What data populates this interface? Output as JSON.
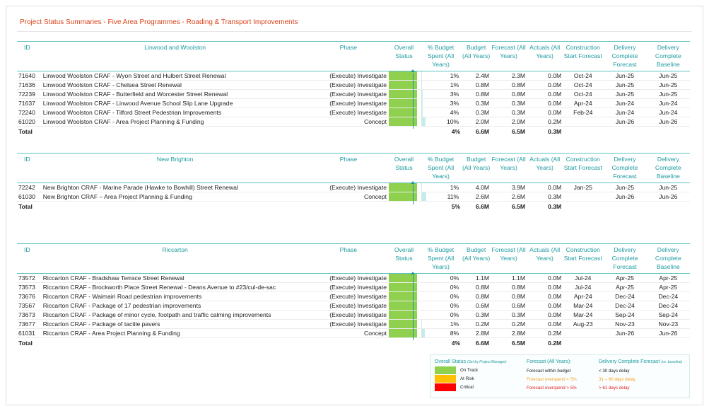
{
  "report_title": "Project Status Summaries - Five Area Programmes - Roading & Transport Improvements",
  "columns": {
    "id": "ID",
    "phase": "Phase",
    "overall_status": "Overall Status",
    "budget_spent": "% Budget Spent (All Years)",
    "budget": "Budget (All Years)",
    "forecast": "Forecast (All Years)",
    "actuals": "Actuals (All Years)",
    "construction_start": "Construction Start Forecast",
    "delivery_forecast": "Delivery Complete Forecast",
    "delivery_baseline": "Delivery Complete Baseline"
  },
  "sections": [
    {
      "name": "Linwood and Woolston",
      "rows": [
        {
          "id": "71640",
          "name": "Linwood Woolston CRAF - Wyon Street and Hulbert Street Renewal",
          "phase": "(Execute) Investigate",
          "status": "On Track",
          "pct": "1%",
          "pct_value": 1,
          "budget": "2.4M",
          "forecast": "2.3M",
          "actuals": "0.0M",
          "cons": "Oct-24",
          "deliv_f": "Jun-25",
          "deliv_b": "Jun-25"
        },
        {
          "id": "71636",
          "name": "Linwood Woolston CRAF - Chelsea Street Renewal",
          "phase": "(Execute) Investigate",
          "status": "On Track",
          "pct": "1%",
          "pct_value": 1,
          "budget": "0.8M",
          "forecast": "0.8M",
          "actuals": "0.0M",
          "cons": "Oct-24",
          "deliv_f": "Jun-25",
          "deliv_b": "Jun-25"
        },
        {
          "id": "72239",
          "name": "Linwood Woolston CRAF - Butterfield and Worcester Street Renewal",
          "phase": "(Execute) Investigate",
          "status": "On Track",
          "pct": "3%",
          "pct_value": 3,
          "budget": "0.8M",
          "forecast": "0.8M",
          "actuals": "0.0M",
          "cons": "Oct-24",
          "deliv_f": "Jun-25",
          "deliv_b": "Jun-25"
        },
        {
          "id": "71637",
          "name": "Linwood Woolston CRAF - Linwood Avenue School Slip Lane Upgrade",
          "phase": "(Execute) Investigate",
          "status": "On Track",
          "pct": "3%",
          "pct_value": 3,
          "budget": "0.3M",
          "forecast": "0.3M",
          "actuals": "0.0M",
          "cons": "Apr-24",
          "deliv_f": "Jun-24",
          "deliv_b": "Jun-24"
        },
        {
          "id": "72240",
          "name": "Linwood Woolston CRAF - Tilford Street Pedestrian Improvements",
          "phase": "(Execute) Investigate",
          "status": "On Track",
          "pct": "4%",
          "pct_value": 4,
          "budget": "0.3M",
          "forecast": "0.3M",
          "actuals": "0.0M",
          "cons": "Feb-24",
          "deliv_f": "Jun-24",
          "deliv_b": "Jun-24"
        },
        {
          "id": "61020",
          "name": "Linwood Woolston CRAF - Area Project Planning & Funding",
          "phase": "Concept",
          "status": "On Track",
          "pct": "10%",
          "pct_value": 10,
          "budget": "2.0M",
          "forecast": "2.0M",
          "actuals": "0.2M",
          "cons": "",
          "deliv_f": "Jun-26",
          "deliv_b": "Jun-26"
        }
      ],
      "total": {
        "label": "Total",
        "pct": "4%",
        "budget": "6.6M",
        "forecast": "6.5M",
        "actuals": "0.3M"
      }
    },
    {
      "name": "New Brighton",
      "rows": [
        {
          "id": "72242",
          "name": "New Brighton CRAF - Marine Parade (Hawke to Bowhill) Street Renewal",
          "phase": "(Execute) Investigate",
          "status": "On Track",
          "pct": "1%",
          "pct_value": 1,
          "budget": "4.0M",
          "forecast": "3.9M",
          "actuals": "0.0M",
          "cons": "Jan-25",
          "deliv_f": "Jun-25",
          "deliv_b": "Jun-25"
        },
        {
          "id": "61030",
          "name": "New Brighton CRAF – Area Project Planning & Funding",
          "phase": "Concept",
          "status": "On Track",
          "pct": "11%",
          "pct_value": 11,
          "budget": "2.6M",
          "forecast": "2.6M",
          "actuals": "0.3M",
          "cons": "",
          "deliv_f": "Jun-26",
          "deliv_b": "Jun-26"
        }
      ],
      "total": {
        "label": "Total",
        "pct": "5%",
        "budget": "6.6M",
        "forecast": "6.5M",
        "actuals": "0.3M"
      }
    },
    {
      "name": "Riccarton",
      "rows": [
        {
          "id": "73572",
          "name": "Riccarton CRAF - Bradshaw Terrace Street Renewal",
          "phase": "(Execute) Investigate",
          "status": "On Track",
          "pct": "0%",
          "pct_value": 0,
          "budget": "1.1M",
          "forecast": "1.1M",
          "actuals": "0.0M",
          "cons": "Jul-24",
          "deliv_f": "Apr-25",
          "deliv_b": "Apr-25"
        },
        {
          "id": "73573",
          "name": "Riccarton CRAF - Brockworth Place Street Renewal - Deans Avenue to #23/cul-de-sac",
          "phase": "(Execute) Investigate",
          "status": "On Track",
          "pct": "0%",
          "pct_value": 0,
          "budget": "0.8M",
          "forecast": "0.8M",
          "actuals": "0.0M",
          "cons": "Jul-24",
          "deliv_f": "Apr-25",
          "deliv_b": "Apr-25"
        },
        {
          "id": "73676",
          "name": "Riccarton CRAF - Waimairi Road pedestrian improvements",
          "phase": "(Execute) Investigate",
          "status": "On Track",
          "pct": "0%",
          "pct_value": 0,
          "budget": "0.8M",
          "forecast": "0.8M",
          "actuals": "0.0M",
          "cons": "Apr-24",
          "deliv_f": "Dec-24",
          "deliv_b": "Dec-24"
        },
        {
          "id": "73567",
          "name": "Riccarton CRAF - Package of 17 pedestrian improvements",
          "phase": "(Execute) Investigate",
          "status": "On Track",
          "pct": "0%",
          "pct_value": 0,
          "budget": "0.6M",
          "forecast": "0.6M",
          "actuals": "0.0M",
          "cons": "Mar-24",
          "deliv_f": "Dec-24",
          "deliv_b": "Dec-24"
        },
        {
          "id": "73673",
          "name": "Riccarton CRAF - Package of minor cycle, footpath and traffic calming improvements",
          "phase": "(Execute) Investigate",
          "status": "On Track",
          "pct": "0%",
          "pct_value": 0,
          "budget": "0.3M",
          "forecast": "0.3M",
          "actuals": "0.0M",
          "cons": "Mar-24",
          "deliv_f": "Sep-24",
          "deliv_b": "Sep-24"
        },
        {
          "id": "73677",
          "name": "Riccarton CRAF - Package of tactile pavers",
          "phase": "(Execute) Investigate",
          "status": "On Track",
          "pct": "1%",
          "pct_value": 1,
          "budget": "0.2M",
          "forecast": "0.2M",
          "actuals": "0.0M",
          "cons": "Aug-23",
          "deliv_f": "Nov-23",
          "deliv_b": "Nov-23"
        },
        {
          "id": "61031",
          "name": "Riccarton CRAF - Area Project Planning & Funding",
          "phase": "Concept",
          "status": "On Track",
          "pct": "8%",
          "pct_value": 8,
          "budget": "2.8M",
          "forecast": "2.8M",
          "actuals": "0.2M",
          "cons": "",
          "deliv_f": "Jun-26",
          "deliv_b": "Jun-26"
        }
      ],
      "total": {
        "label": "Total",
        "pct": "4%",
        "budget": "6.6M",
        "forecast": "6.5M",
        "actuals": "0.2M"
      }
    }
  ],
  "legend": {
    "status_title": "Overall Status",
    "status_note": "(Set by Project Manager)",
    "items": [
      {
        "label": "On Track",
        "color": "#8fd14f"
      },
      {
        "label": "At Risk",
        "color": "#ffc000"
      },
      {
        "label": "Critical",
        "color": "#ff0000"
      }
    ],
    "forecast_title": "Forecast (All Years):",
    "forecast_items": [
      {
        "text": "Forecast within budget",
        "color": "#222222"
      },
      {
        "text": "Forecast overspend < 5%",
        "color": "#f0a020"
      },
      {
        "text": "Forecast overspend > 5%",
        "color": "#e02020"
      }
    ],
    "delivery_title": "Delivery Complete Forecast",
    "delivery_note": "(vs. baseline)",
    "delivery_items": [
      {
        "text": "< 30 days delay",
        "color": "#222222"
      },
      {
        "text": "31 – 60 days delay",
        "color": "#f0a020"
      },
      {
        "text": "> 61 days delay",
        "color": "#e02020"
      }
    ]
  },
  "colors": {
    "accent": "#1f9ba0",
    "title": "#d9441b",
    "on_track": "#8fd14f",
    "budget_bar": "#c7ece8"
  }
}
